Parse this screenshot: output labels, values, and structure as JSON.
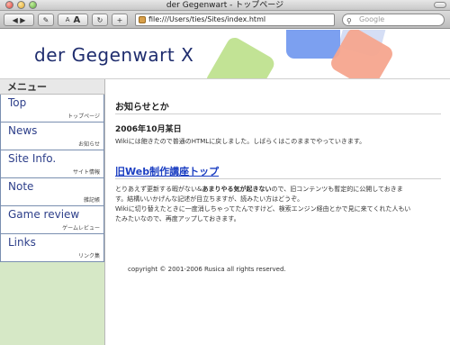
{
  "window": {
    "title": "der Gegenwart - トップページ"
  },
  "toolbar": {
    "back_forward": "◀ ▶",
    "edit_icon": "✎",
    "text_smaller": "A",
    "text_larger": "A",
    "reload": "↻",
    "add": "+",
    "address": "file:///Users/ties/Sites/index.html",
    "search_placeholder": "Google"
  },
  "site": {
    "title": "der Gegenwart X",
    "shape_colors": [
      "#bfe28f",
      "#6e96ee",
      "#f6a58e",
      "#c7d3f2"
    ]
  },
  "sidebar": {
    "heading": "メニュー",
    "items": [
      {
        "label": "Top",
        "sub": "トップページ"
      },
      {
        "label": "News",
        "sub": "お知らせ"
      },
      {
        "label": "Site Info.",
        "sub": "サイト情報"
      },
      {
        "label": "Note",
        "sub": "雑記帳"
      },
      {
        "label": "Game review",
        "sub": "ゲームレビュー"
      },
      {
        "label": "Links",
        "sub": "リンク集"
      }
    ]
  },
  "main": {
    "heading": "お知らせとか",
    "date": "2006年10月某日",
    "news_text": "Wikiには飽きたので普通のHTMLに戻しました。しばらくはこのままでやっていきます。",
    "old_link": "旧Web制作講座トップ",
    "desc_line1_a": "とりあえず更新する暇がない&",
    "desc_line1_b": "あまりやる気が起きない",
    "desc_line1_c": "ので、旧コンテンツも暫定的に公開しておきま",
    "desc_line2": "す。結構いいかげんな記述が目立ちますが、読みたい方はどうぞ。",
    "desc_line3": "Wikiに切り替えたときに一度消しちゃってたんですけど、検索エンジン経由とかで見に来てくれた人もい",
    "desc_line4": "たみたいなので、再度アップしておきます。",
    "copyright": "copyright © 2001-2006 Rusica all rights reserved."
  }
}
